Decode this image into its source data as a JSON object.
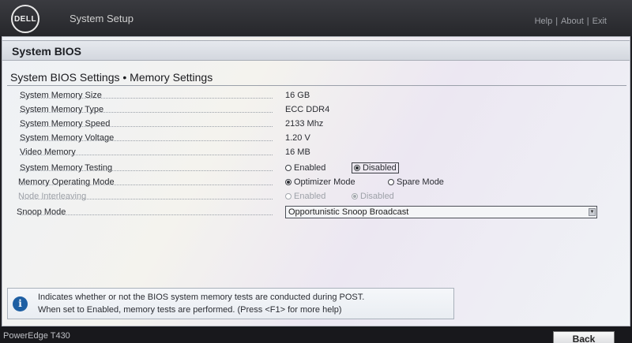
{
  "header": {
    "logo_text": "DELL",
    "app_title": "System Setup",
    "links": [
      "Help",
      "|",
      "About",
      "|",
      "Exit"
    ]
  },
  "section": {
    "title": "System BIOS"
  },
  "page": {
    "title": "System BIOS Settings • Memory Settings"
  },
  "settings": {
    "memory_size": {
      "label": "System Memory Size",
      "value": "16 GB"
    },
    "memory_type": {
      "label": "System Memory Type",
      "value": "ECC DDR4"
    },
    "memory_speed": {
      "label": "System Memory Speed",
      "value": "2133 Mhz"
    },
    "memory_voltage": {
      "label": "System Memory Voltage",
      "value": "1.20 V"
    },
    "video_memory": {
      "label": "Video Memory",
      "value": "16 MB"
    },
    "memory_testing": {
      "label": "System Memory Testing",
      "options": [
        "Enabled",
        "Disabled"
      ],
      "selected": "Disabled"
    },
    "operating_mode": {
      "label": "Memory Operating Mode",
      "options": [
        "Optimizer Mode",
        "Spare Mode"
      ],
      "selected": "Optimizer Mode"
    },
    "node_interleaving": {
      "label": "Node Interleaving",
      "options": [
        "Enabled",
        "Disabled"
      ],
      "selected": "Disabled",
      "enabled": false
    },
    "snoop_mode": {
      "label": "Snoop Mode",
      "value": "Opportunistic Snoop Broadcast"
    }
  },
  "help": {
    "line1": "Indicates whether or not the BIOS system memory tests are conducted during POST.",
    "line2": "When set to Enabled, memory tests are performed. (Press <F1> for more help)"
  },
  "footer": {
    "model": "PowerEdge T430",
    "back_label": "Back"
  }
}
